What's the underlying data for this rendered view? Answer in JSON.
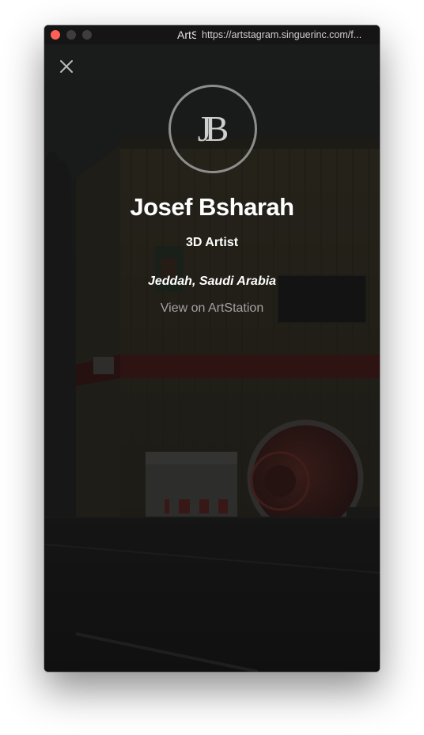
{
  "window": {
    "title": "ArtS",
    "url": "https://artstagram.singuerinc.com/f..."
  },
  "profile": {
    "monogram": "JB",
    "name": "Josef Bsharah",
    "headline": "3D Artist",
    "location": "Jeddah, Saudi Arabia",
    "link_label": "View on ArtStation"
  },
  "colors": {
    "close_light": "#ff5f57",
    "inactive_light": "#3d3d3d",
    "link_text": "#a2a2a2",
    "avatar_ring": "#8d8d8d"
  },
  "icons": [
    "close-icon"
  ]
}
